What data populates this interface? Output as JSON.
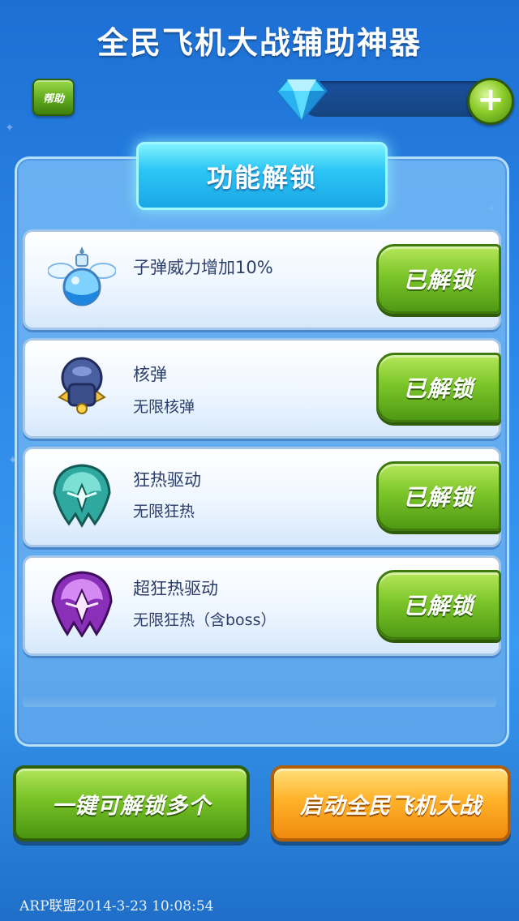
{
  "header": {
    "title": "全民飞机大战辅助神器",
    "help_label": "帮助",
    "plus_label": "+"
  },
  "panel": {
    "title": "功能解锁",
    "features": [
      {
        "title": "子弹威力增加10%",
        "subtitle": "",
        "button_label": "已解锁",
        "icon": "potion-icon"
      },
      {
        "title": "核弹",
        "subtitle": "无限核弹",
        "button_label": "已解锁",
        "icon": "nuke-bomb-icon"
      },
      {
        "title": "狂热驱动",
        "subtitle": "无限狂热",
        "button_label": "已解锁",
        "icon": "frenzy-shield-teal-icon"
      },
      {
        "title": "超狂热驱动",
        "subtitle": "无限狂热（含boss）",
        "button_label": "已解锁",
        "icon": "super-frenzy-shield-purple-icon"
      }
    ]
  },
  "actions": {
    "bulk_unlock_label": "一键可解锁多个",
    "launch_game_label": "启动全民飞机大战"
  },
  "watermark": "ARP联盟2014-3-23 10:08:54",
  "colors": {
    "accent_green": "#7cc62a",
    "accent_orange": "#ffb22a",
    "panel_blue": "#62a8ec",
    "title_cyan": "#2dc6f5"
  }
}
